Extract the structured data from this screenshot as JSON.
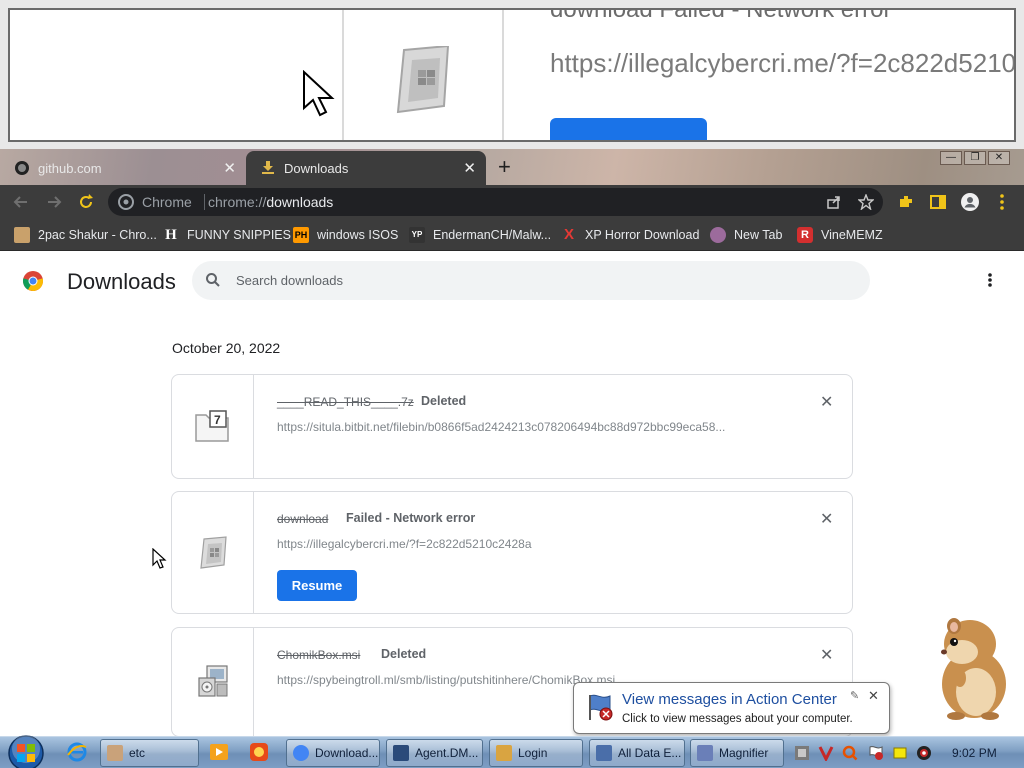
{
  "magnifier": {
    "title_fragment": "download   Failed - Network error",
    "url_fragment": "https://illegalcybercri.me/?f=2c822d5210"
  },
  "tabs": [
    {
      "label": "github.com",
      "close": "✕"
    },
    {
      "label": "Downloads",
      "close": "✕"
    }
  ],
  "new_tab": "+",
  "window_controls": {
    "minimize": "—",
    "restore": "❐",
    "close": "✕"
  },
  "omnibox": {
    "scheme_label": "Chrome",
    "url_prefix": "chrome://",
    "url_path": "downloads"
  },
  "bookmarks": [
    {
      "label": "2pac Shakur - Chro...",
      "icon": "tupac-avatar-icon",
      "color": "#c9a16b"
    },
    {
      "label": "FUNNY SNIPPIES",
      "icon": "letter-h-icon",
      "color": "#ffffff"
    },
    {
      "label": "windows ISOS",
      "icon": "ph-icon",
      "color": "#ff9900"
    },
    {
      "label": "EndermanCH/Malw...",
      "icon": "yp-icon",
      "color": "#333333"
    },
    {
      "label": "XP Horror Download",
      "icon": "red-x-icon",
      "color": "#e53935"
    },
    {
      "label": "New Tab",
      "icon": "globe-icon",
      "color": "#9c6b9c"
    },
    {
      "label": "VineMEMZ",
      "icon": "vine-r-icon",
      "color": "#d32f2f"
    }
  ],
  "page": {
    "title": "Downloads",
    "search_placeholder": "Search downloads",
    "date": "October 20, 2022"
  },
  "downloads": [
    {
      "name": "____READ_THIS____.7z",
      "status": "Deleted",
      "url": "https://situla.bitbit.net/filebin/b0866f5ad2424213c078206494bc88d972bbc99eca58...",
      "icon": "7z-file-icon"
    },
    {
      "name": "download",
      "status": "Failed - Network error",
      "url": "https://illegalcybercri.me/?f=2c822d5210c2428a",
      "action": "Resume",
      "icon": "generic-file-icon"
    },
    {
      "name": "ChomikBox.msi",
      "status": "Deleted",
      "url": "https://spybeingtroll.ml/smb/listing/putshitinhere/ChomikBox.msi",
      "icon": "msi-installer-icon"
    }
  ],
  "balloon": {
    "title": "View messages in Action Center",
    "text": "Click to view messages about your computer.",
    "close": "✕"
  },
  "taskbar": {
    "tasks": [
      {
        "label": "etc",
        "color": "#c9a27a"
      },
      {
        "label": "Download...",
        "color": "#4285f4"
      },
      {
        "label": "Agent.DM...",
        "color": "#2a4a7a"
      },
      {
        "label": "Login",
        "color": "#d9a441"
      },
      {
        "label": "All Data E...",
        "color": "#4a6ea9"
      },
      {
        "label": "Magnifier",
        "color": "#6a7fb8"
      }
    ],
    "clock": "9:02 PM"
  }
}
